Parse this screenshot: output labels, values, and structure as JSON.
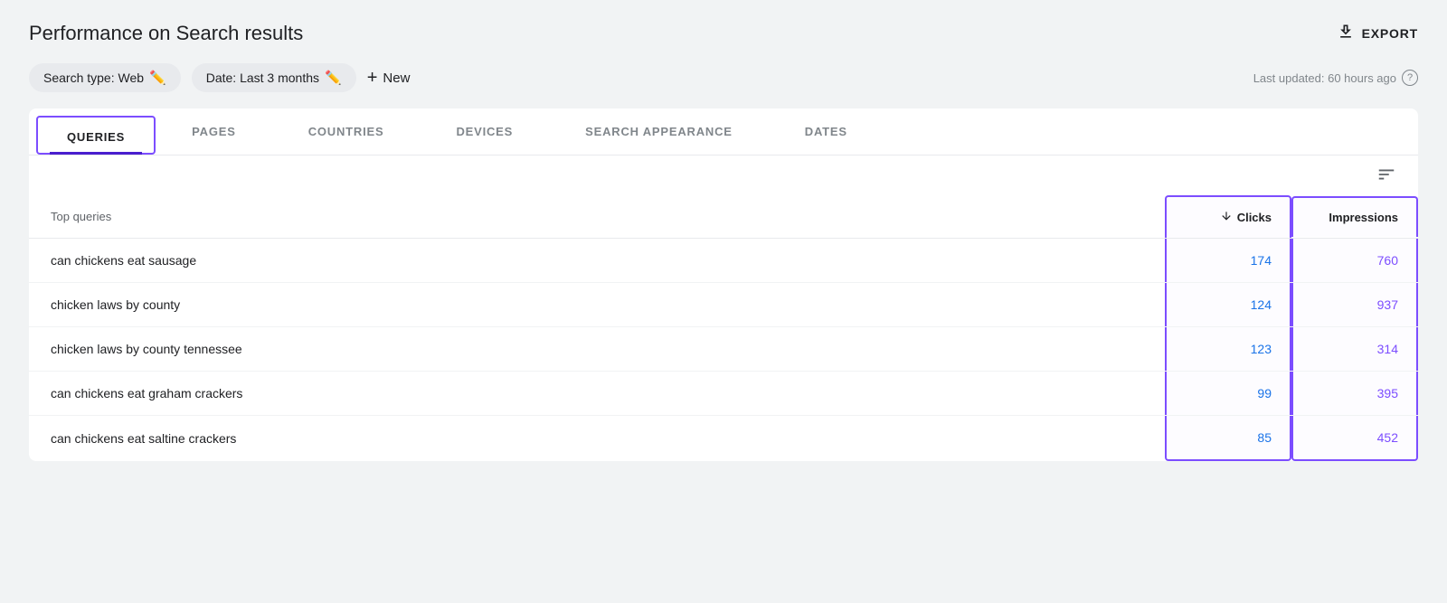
{
  "page": {
    "title": "Performance on Search results"
  },
  "header": {
    "export_label": "EXPORT",
    "last_updated": "Last updated: 60 hours ago"
  },
  "filters": {
    "search_type_label": "Search type: Web",
    "date_label": "Date: Last 3 months",
    "new_label": "New"
  },
  "tabs": [
    {
      "id": "queries",
      "label": "QUERIES",
      "active": true
    },
    {
      "id": "pages",
      "label": "PAGES",
      "active": false
    },
    {
      "id": "countries",
      "label": "COUNTRIES",
      "active": false
    },
    {
      "id": "devices",
      "label": "DEVICES",
      "active": false
    },
    {
      "id": "search-appearance",
      "label": "SEARCH APPEARANCE",
      "active": false
    },
    {
      "id": "dates",
      "label": "DATES",
      "active": false
    }
  ],
  "table": {
    "top_queries_label": "Top queries",
    "col_clicks": "Clicks",
    "col_impressions": "Impressions",
    "rows": [
      {
        "query": "can chickens eat sausage",
        "clicks": "174",
        "impressions": "760"
      },
      {
        "query": "chicken laws by county",
        "clicks": "124",
        "impressions": "937"
      },
      {
        "query": "chicken laws by county tennessee",
        "clicks": "123",
        "impressions": "314"
      },
      {
        "query": "can chickens eat graham crackers",
        "clicks": "99",
        "impressions": "395"
      },
      {
        "query": "can chickens eat saltine crackers",
        "clicks": "85",
        "impressions": "452"
      }
    ]
  }
}
